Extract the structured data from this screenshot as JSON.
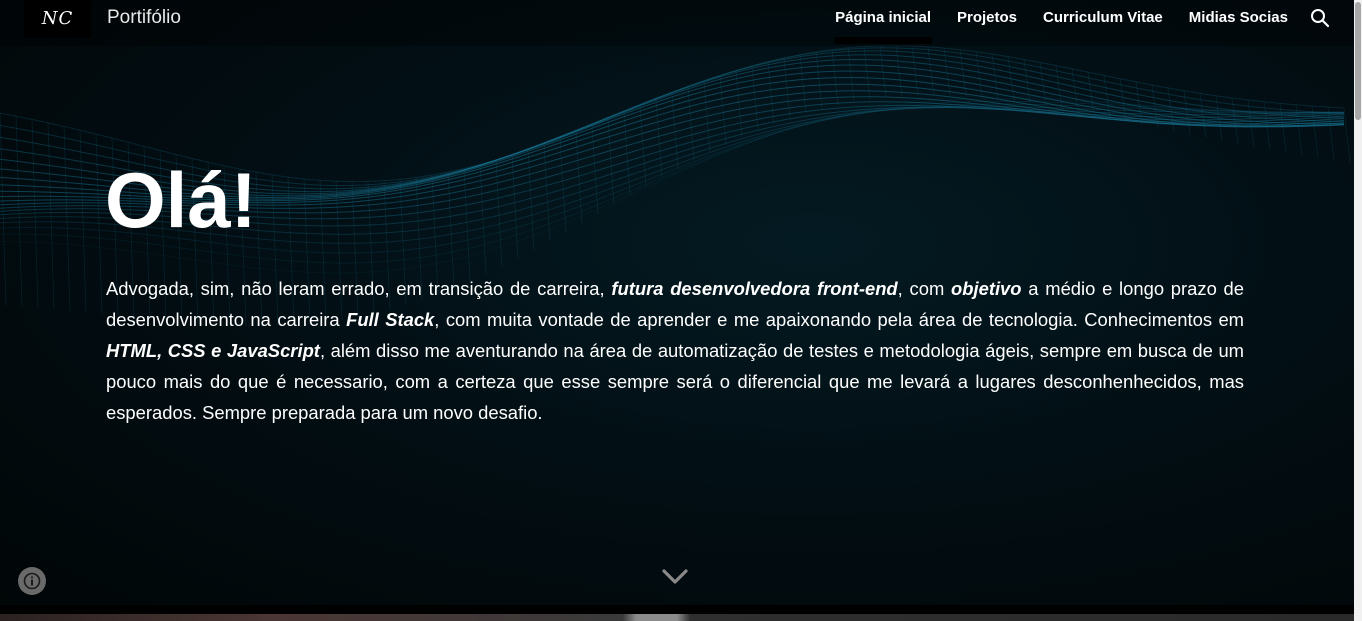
{
  "header": {
    "logo_text": "NC",
    "site_name": "Portifólio",
    "nav": [
      {
        "label": "Página inicial",
        "active": true
      },
      {
        "label": "Projetos"
      },
      {
        "label": "Curriculum Vitae"
      },
      {
        "label": "Midias Socias"
      }
    ],
    "search_icon": "search-icon"
  },
  "hero": {
    "title": "Olá!",
    "paragraph": {
      "t1": "Advogada, sim, não leram errado, em transição de carreira, ",
      "b1": "futura desenvolvedora front-end",
      "t2": ", com ",
      "b2": "objetivo",
      "t3": " a médio e longo prazo de desenvolvimento na carreira ",
      "b3": "Full Stack",
      "t4": ", com muita vontade de aprender e me apaixonando pela área de tecnologia. Conhecimentos em ",
      "b4": "HTML, CSS e JavaScript",
      "t5": ", além disso me aventurando na área de automatização de testes e metodologia ágeis, sempre em busca de um pouco mais do que é necessario, com a certeza que esse sempre será o diferencial que me levará a lugares desconhenhecidos, mas esperados. Sempre preparada para um novo desafio."
    },
    "scroll_icon": "chevron-down-icon"
  },
  "footer": {
    "info_icon": "info-icon"
  },
  "colors": {
    "background": "#020d12",
    "wave": "#1a7fa0",
    "text": "#ffffff"
  }
}
